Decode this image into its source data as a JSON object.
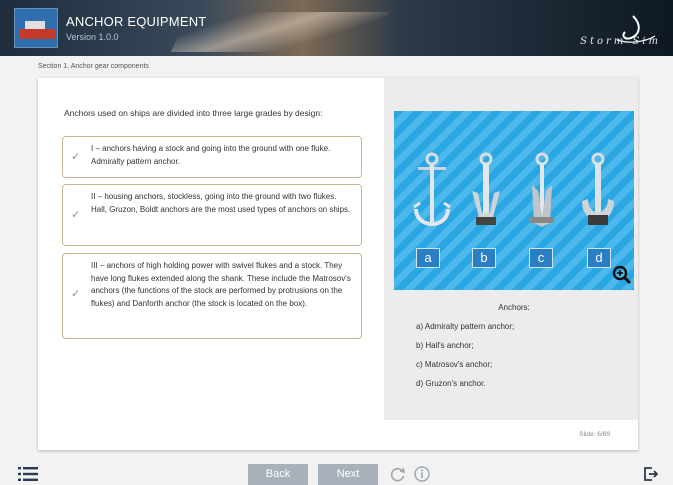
{
  "header": {
    "title": "ANCHOR EQUIPMENT",
    "subtitle": "Version 1.0.0",
    "brand": "Storm Sim"
  },
  "section": "Section 1. Anchor gear components",
  "content": {
    "intro": "Anchors used on ships are divided into three large grades by design:",
    "items": [
      {
        "text": "I – anchors having a stock and going into the ground with one fluke. Admiralty pattern anchor."
      },
      {
        "text": "II – housing anchors, stockless, going into the ground with two flukes. Hall, Gruzon, Boldt anchors are the most used types of anchors on ships."
      },
      {
        "text": "III – anchors of high holding power with swivel flukes and a stock. They have long flukes extended along the shank. These include the Matrosov's anchors (the functions of the stock are performed by protrusions on the flukes) and Danforth anchor (the stock is located on the box)."
      }
    ]
  },
  "figure": {
    "labels": [
      "a",
      "b",
      "c",
      "d"
    ],
    "caption_title": "Anchors:",
    "caption_lines": [
      "a) Admiralty pattern anchor;",
      "b) Hall's anchor;",
      "c) Matrosov's anchor;",
      "d) Gruzon's anchor."
    ]
  },
  "slide": "Slide: 6/89",
  "footer": {
    "back": "Back",
    "next": "Next"
  },
  "icons": {
    "check": "check-icon",
    "zoom": "zoom-in-icon",
    "menu": "menu-list-icon",
    "reload": "reload-icon",
    "info": "info-icon",
    "exit": "exit-icon"
  },
  "colors": {
    "accent_border": "#c9b791",
    "button": "#a8b1ba",
    "figure_bg": "#2aa6e3"
  }
}
